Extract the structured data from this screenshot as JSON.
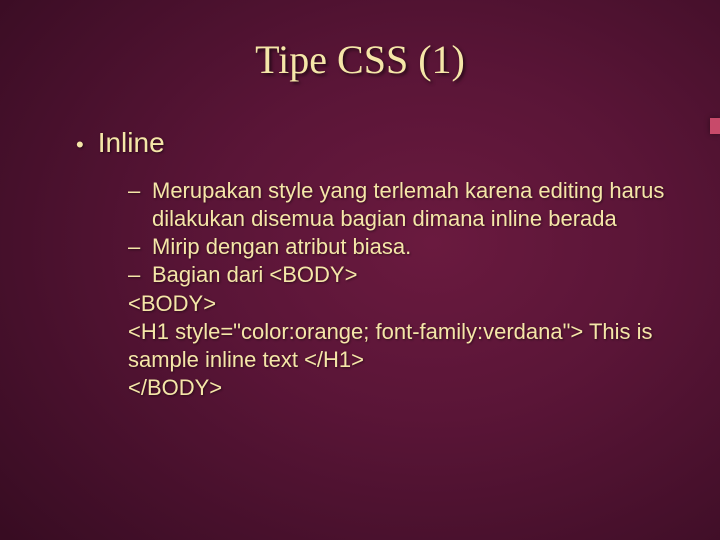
{
  "title": "Tipe CSS (1)",
  "bullet_l1": "Inline",
  "sub": {
    "item1": "Merupakan style yang terlemah karena editing harus dilakukan disemua bagian dimana inline berada",
    "item2": "Mirip dengan atribut biasa.",
    "item3": "Bagian dari <BODY>",
    "code1": "<BODY>",
    "code2": "<H1 style=\"color:orange; font-family:verdana\"> This is sample inline text </H1>",
    "code3": "</BODY>"
  }
}
